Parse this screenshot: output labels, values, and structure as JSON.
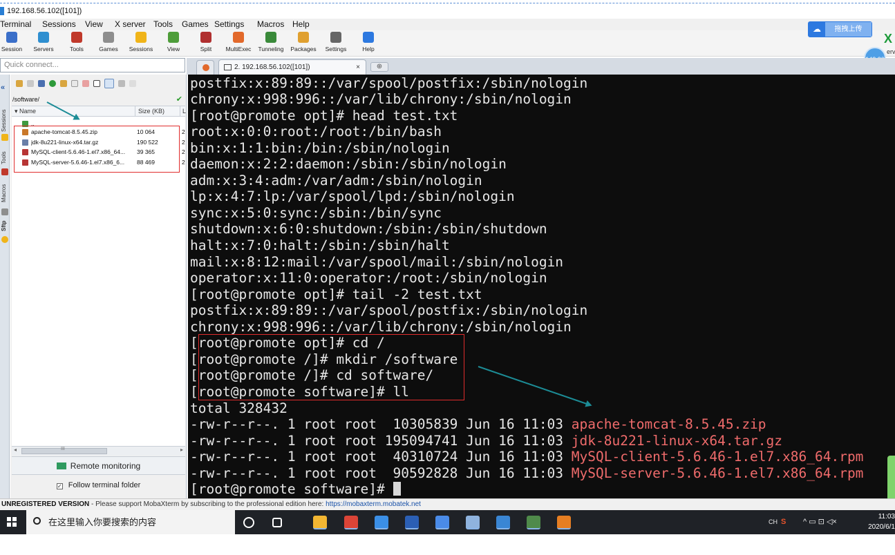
{
  "window": {
    "title": "192.168.56.102([101])"
  },
  "menu": [
    "Terminal",
    "Sessions",
    "View",
    "X server",
    "Tools",
    "Games",
    "Settings",
    "Macros",
    "Help"
  ],
  "toolbar": [
    {
      "label": "Session",
      "icon": "session-icon",
      "color": "#3b6fc9"
    },
    {
      "label": "Servers",
      "icon": "servers-icon",
      "color": "#2f8fd0"
    },
    {
      "label": "Tools",
      "icon": "tools-icon",
      "color": "#c0392b"
    },
    {
      "label": "Games",
      "icon": "games-icon",
      "color": "#8e8e8e"
    },
    {
      "label": "Sessions",
      "icon": "star-icon",
      "color": "#f0b419"
    },
    {
      "label": "View",
      "icon": "view-icon",
      "color": "#4e9d3a"
    },
    {
      "label": "Split",
      "icon": "split-icon",
      "color": "#b03030"
    },
    {
      "label": "MultiExec",
      "icon": "multiexec-icon",
      "color": "#e2692b"
    },
    {
      "label": "Tunneling",
      "icon": "tunneling-icon",
      "color": "#3a8a3a"
    },
    {
      "label": "Packages",
      "icon": "packages-icon",
      "color": "#e0a030"
    },
    {
      "label": "Settings",
      "icon": "settings-icon",
      "color": "#666666"
    },
    {
      "label": "Help",
      "icon": "help-icon",
      "color": "#2d79e0"
    }
  ],
  "cloud": {
    "icon": "cloud-icon",
    "label": "拖拽上传"
  },
  "badge": {
    "text": "142:30",
    "side_text": "erv"
  },
  "quick_connect": {
    "placeholder": "Quick connect..."
  },
  "tabs": {
    "active_label": "2. 192.168.56.102([101])",
    "close": "×",
    "plus": "⊕"
  },
  "rail": [
    "Sessions",
    "Tools",
    "Macros",
    "Sftp"
  ],
  "sftp": {
    "path": "/software/",
    "columns": [
      "Name",
      "Size (KB)",
      "L"
    ],
    "rows": [
      {
        "name": "..",
        "size": "",
        "extra": "",
        "icon": "folder-up-icon",
        "color": "#3f9a3f"
      },
      {
        "name": "apache-tomcat-8.5.45.zip",
        "size": "10 064",
        "extra": "2",
        "icon": "zip-icon",
        "color": "#c9782a"
      },
      {
        "name": "jdk-8u221-linux-x64.tar.gz",
        "size": "190 522",
        "extra": "2",
        "icon": "archive-icon",
        "color": "#6a7fa8"
      },
      {
        "name": "MySQL-client-5.6.46-1.el7.x86_64...",
        "size": "39 365",
        "extra": "2",
        "icon": "rpm-icon",
        "color": "#b73535"
      },
      {
        "name": "MySQL-server-5.6.46-1.el7.x86_6...",
        "size": "88 469",
        "extra": "2",
        "icon": "rpm-icon",
        "color": "#b73535"
      }
    ],
    "scroll_mid": "III",
    "remote_monitoring": "Remote monitoring",
    "follow_folder": "Follow terminal folder"
  },
  "terminal": {
    "lines": [
      {
        "t": "postfix:x:89:89::/var/spool/postfix:/sbin/nologin"
      },
      {
        "t": "chrony:x:998:996::/var/lib/chrony:/sbin/nologin"
      },
      {
        "t": "[root@promote opt]# head test.txt"
      },
      {
        "t": "root:x:0:0:root:/root:/bin/bash"
      },
      {
        "t": "bin:x:1:1:bin:/bin:/sbin/nologin"
      },
      {
        "t": "daemon:x:2:2:daemon:/sbin:/sbin/nologin"
      },
      {
        "t": "adm:x:3:4:adm:/var/adm:/sbin/nologin"
      },
      {
        "t": "lp:x:4:7:lp:/var/spool/lpd:/sbin/nologin"
      },
      {
        "t": "sync:x:5:0:sync:/sbin:/bin/sync"
      },
      {
        "t": "shutdown:x:6:0:shutdown:/sbin:/sbin/shutdown"
      },
      {
        "t": "halt:x:7:0:halt:/sbin:/sbin/halt"
      },
      {
        "t": "mail:x:8:12:mail:/var/spool/mail:/sbin/nologin"
      },
      {
        "t": "operator:x:11:0:operator:/root:/sbin/nologin"
      },
      {
        "t": "[root@promote opt]# tail -2 test.txt"
      },
      {
        "t": "postfix:x:89:89::/var/spool/postfix:/sbin/nologin"
      },
      {
        "t": "chrony:x:998:996::/var/lib/chrony:/sbin/nologin"
      },
      {
        "t": "[root@promote opt]# cd /"
      },
      {
        "t": "[root@promote /]# mkdir /software"
      },
      {
        "t": "[root@promote /]# cd software/"
      },
      {
        "t": "[root@promote software]# ll"
      },
      {
        "t": "total 328432"
      },
      {
        "t": "-rw-r--r--. 1 root root  10305839 Jun 16 11:03 ",
        "r": "apache-tomcat-8.5.45.zip"
      },
      {
        "t": "-rw-r--r--. 1 root root 195094741 Jun 16 11:03 ",
        "r": "jdk-8u221-linux-x64.tar.gz"
      },
      {
        "t": "-rw-r--r--. 1 root root  40310724 Jun 16 11:03 ",
        "r": "MySQL-client-5.6.46-1.el7.x86_64.rpm"
      },
      {
        "t": "-rw-r--r--. 1 root root  90592828 Jun 16 11:03 ",
        "r": "MySQL-server-5.6.46-1.el7.x86_64.rpm"
      },
      {
        "t": "[root@promote software]# ",
        "cursor": true
      }
    ]
  },
  "status": {
    "bold": "UNREGISTERED VERSION",
    "text": "  -  Please support MobaXterm by subscribing to the professional edition here:  ",
    "link": "https://mobaxterm.mobatek.net"
  },
  "taskbar": {
    "search_placeholder": "在这里输入你要搜索的内容",
    "apps": [
      {
        "icon": "cortana-icon",
        "color": "#1f2227"
      },
      {
        "icon": "task-view-icon",
        "color": "#1f2227"
      },
      {
        "icon": "file-explorer-icon",
        "color": "#f2b632"
      },
      {
        "icon": "chrome-icon",
        "color": "#db4437"
      },
      {
        "icon": "pin-app-icon",
        "color": "#3b8fe6"
      },
      {
        "icon": "word-icon",
        "color": "#2b5fb4"
      },
      {
        "icon": "baidu-netdisk-icon",
        "color": "#4a8be8"
      },
      {
        "icon": "virtualbox-icon",
        "color": "#8fb3de"
      },
      {
        "icon": "remote-desktop-icon",
        "color": "#3a86d4"
      },
      {
        "icon": "mobaxterm-icon",
        "color": "#4f8a4a"
      },
      {
        "icon": "media-player-icon",
        "color": "#e67e22"
      }
    ],
    "tray_lang": "CH",
    "tray_ime": "S",
    "tray_icons": "^  ▭  ⊡  ◁×",
    "time": "11:03",
    "date": "2020/6/1"
  }
}
